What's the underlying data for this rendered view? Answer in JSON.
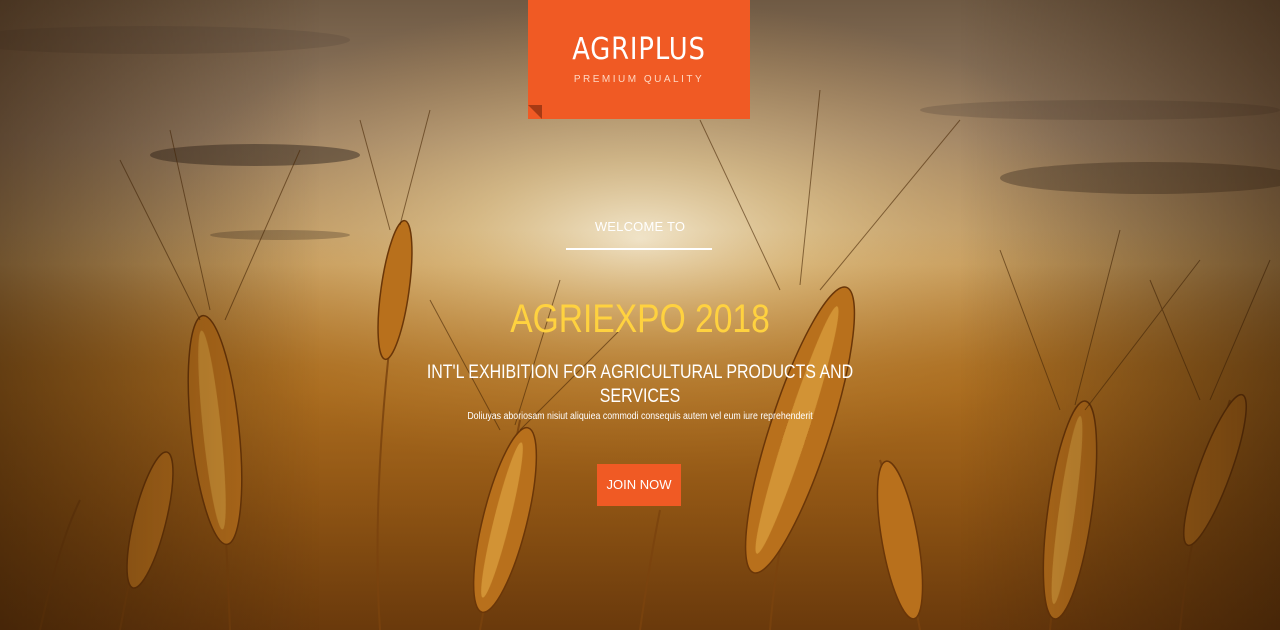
{
  "brand": {
    "name": "AGRIPLUS",
    "tagline": "PREMIUM QUALITY",
    "color": "#f05a24"
  },
  "hero": {
    "welcome": "WELCOME TO",
    "title": "AGRIEXPO 2018",
    "subtitle": "INT'L EXHIBITION FOR AGRICULTURAL PRODUCTS AND SERVICES",
    "description": "Doliuyas aboriosam nisiut aliquiea commodi consequis autem vel eum iure reprehenderit",
    "cta_label": "JOIN NOW",
    "title_color": "#ffd23f"
  }
}
